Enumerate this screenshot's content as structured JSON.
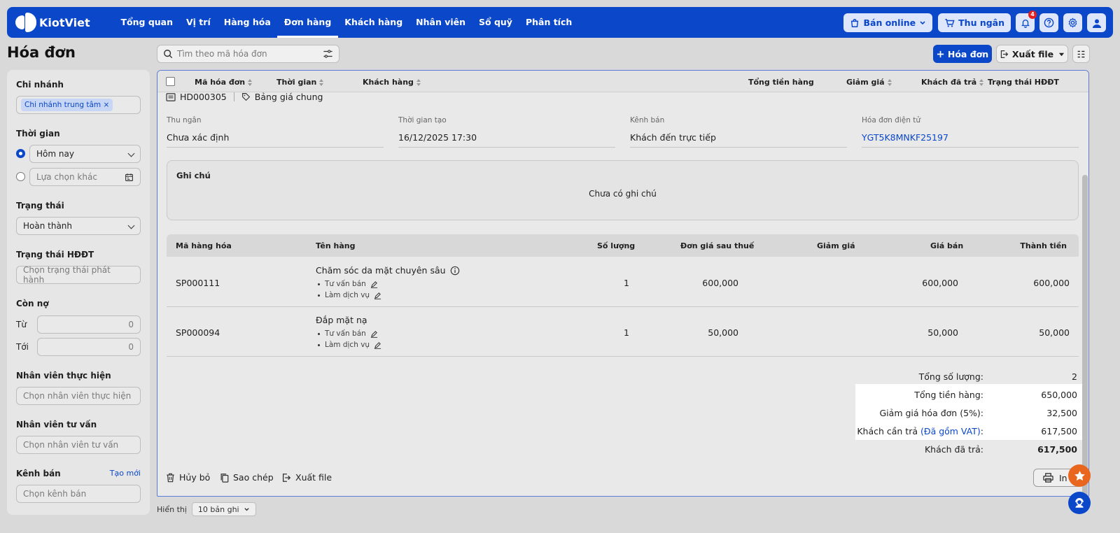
{
  "header": {
    "brand": "KiotViet",
    "nav": [
      "Tổng quan",
      "Vị trí",
      "Hàng hóa",
      "Đơn hàng",
      "Khách hàng",
      "Nhân viên",
      "Sổ quỹ",
      "Phân tích"
    ],
    "active_nav": "Đơn hàng",
    "online_label": "Bán online",
    "cashier_label": "Thu ngân",
    "notification_count": "4"
  },
  "page": {
    "title": "Hóa đơn",
    "search_placeholder": "Tìm theo mã hóa đơn",
    "add_label": "Hóa đơn",
    "export_label": "Xuất file"
  },
  "sidebar": {
    "branch_label": "Chi nhánh",
    "branch_tag": "Chi nhánh trung tâm",
    "time_label": "Thời gian",
    "time_today": "Hôm nay",
    "time_other": "Lựa chọn khác",
    "status_label": "Trạng thái",
    "status_value": "Hoàn thành",
    "einvoice_label": "Trạng thái HĐĐT",
    "einvoice_placeholder": "Chọn trạng thái phát hành",
    "debt_label": "Còn nợ",
    "debt_from_label": "Từ",
    "debt_from_value": "0",
    "debt_to_label": "Tới",
    "debt_to_value": "0",
    "staff_label": "Nhân viên thực hiện",
    "staff_placeholder": "Chọn nhân viên thực hiện",
    "advisor_label": "Nhân viên tư vấn",
    "advisor_placeholder": "Chọn nhân viên tư vấn",
    "channel_label": "Kênh bán",
    "channel_create": "Tạo mới",
    "channel_placeholder": "Chọn kênh bán"
  },
  "table": {
    "columns": [
      "Mã hóa đơn",
      "Thời gian",
      "Khách hàng",
      "Tổng tiền hàng",
      "Giảm giá",
      "Khách đã trả",
      "Trạng thái HĐĐT"
    ]
  },
  "detail": {
    "invoice_code": "HD000305",
    "price_list": "Bảng giá chung",
    "fields": [
      {
        "label": "Thu ngân",
        "value": "Chưa xác định"
      },
      {
        "label": "Thời gian tạo",
        "value": "16/12/2025 17:30"
      },
      {
        "label": "Kênh bán",
        "value": "Khách đến trực tiếp"
      },
      {
        "label": "Hóa đơn điện tử",
        "value": "YGT5K8MNKF25197"
      }
    ],
    "note_title": "Ghi chú",
    "note_text": "Chưa có ghi chú",
    "item_columns": [
      "Mã hàng hóa",
      "Tên hàng",
      "Số lượng",
      "Đơn giá sau thuế",
      "Giảm giá",
      "Giá bán",
      "Thành tiền"
    ],
    "items": [
      {
        "code": "SP000111",
        "name": "Chăm sóc da mặt chuyên sâu",
        "sub1": "Tư vấn bán",
        "sub2": "Làm dịch vụ",
        "qty": "1",
        "unit_price": "600,000",
        "price": "600,000",
        "total": "600,000"
      },
      {
        "code": "SP000094",
        "name": "Đắp mặt nạ",
        "sub1": "Tư vấn bán",
        "sub2": "Làm dịch vụ",
        "qty": "1",
        "unit_price": "50,000",
        "price": "50,000",
        "total": "50,000"
      }
    ],
    "summary": {
      "total_qty_label": "Tổng số lượng:",
      "total_qty": "2",
      "subtotal_label": "Tổng tiền hàng:",
      "subtotal": "650,000",
      "discount_label": "Giảm giá hóa đơn (5%):",
      "discount": "32,500",
      "payable_label": "Khách cần trả",
      "payable_vat": "(Đã gồm VAT)",
      "payable": "617,500",
      "paid_label": "Khách đã trả:",
      "paid": "617,500"
    },
    "actions": {
      "cancel": "Hủy bỏ",
      "copy": "Sao chép",
      "export": "Xuất file",
      "print": "In"
    }
  },
  "footer": {
    "show_label": "Hiển thị",
    "page_size": "10 bản ghi"
  }
}
